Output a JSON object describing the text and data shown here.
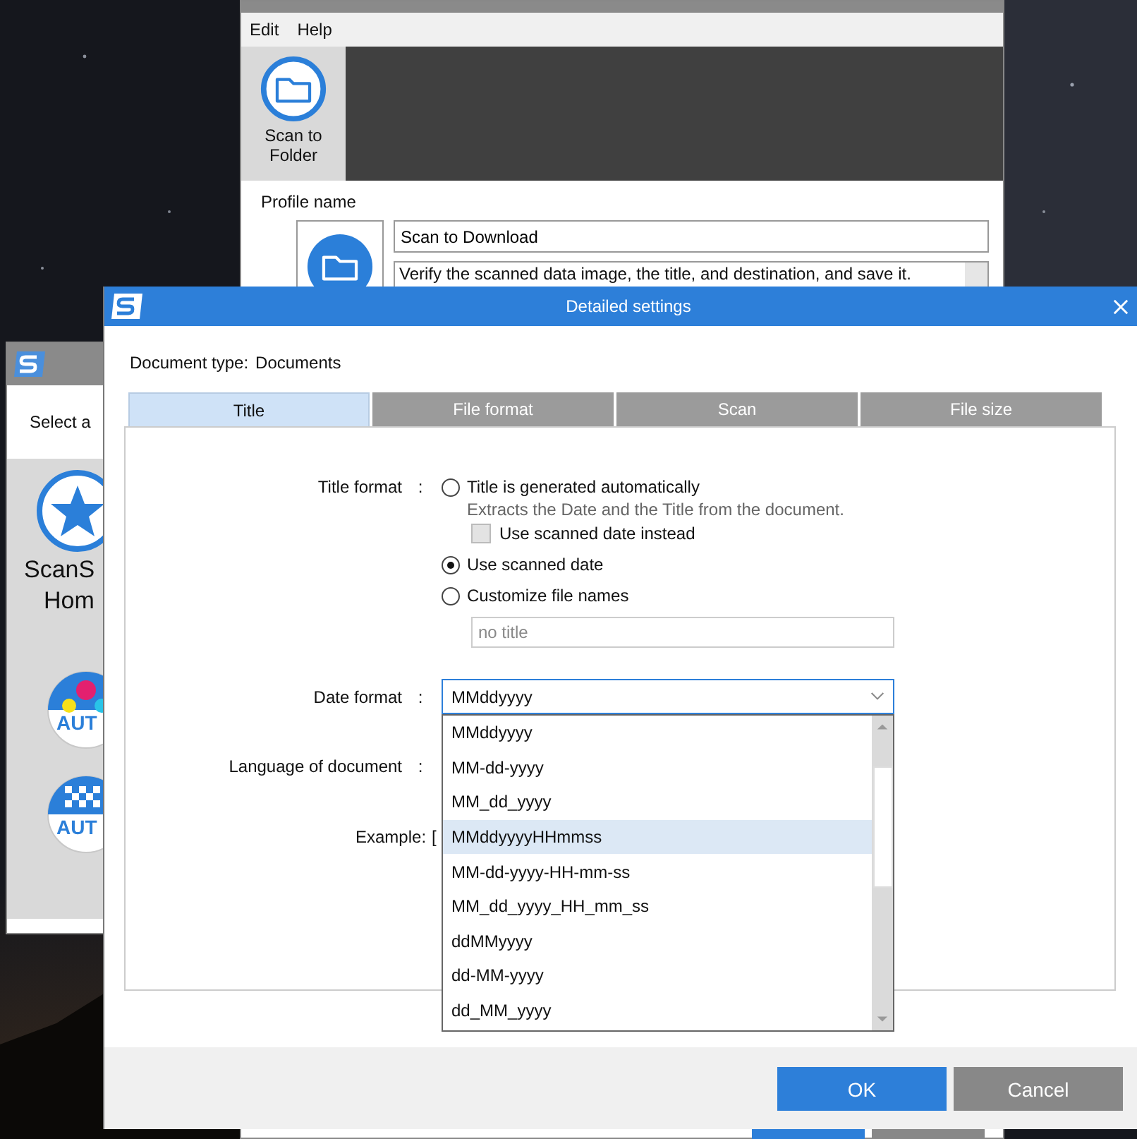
{
  "main_window": {
    "menu": [
      "Edit",
      "Help"
    ],
    "sidebar": [
      {
        "label": "Scan to Folder",
        "selected": true
      }
    ],
    "profile_name_label": "Profile name",
    "profile_name": "Scan to Download",
    "description": "Verify the scanned data image, the title, and destination, and save it."
  },
  "left_window": {
    "prompt": "Select a",
    "items": [
      {
        "kind": "star",
        "lines": [
          "ScanS",
          "Hom"
        ]
      },
      {
        "kind": "color_auto",
        "label": "AUT"
      },
      {
        "kind": "mono_auto",
        "label": "AUT"
      }
    ]
  },
  "dialog": {
    "title": "Detailed settings",
    "document_type_label": "Document type:",
    "document_type": "Documents",
    "tabs": [
      {
        "label": "Title",
        "selected": true
      },
      {
        "label": "File format",
        "selected": false
      },
      {
        "label": "Scan",
        "selected": false
      },
      {
        "label": "File size",
        "selected": false
      }
    ],
    "title_format": {
      "label": "Title format",
      "separator": ":",
      "options": [
        {
          "label": "Title is generated automatically",
          "selected": false,
          "note": "Extracts the Date and the Title from the document.",
          "checkbox": {
            "label": "Use scanned date instead",
            "checked": false,
            "disabled": true
          }
        },
        {
          "label": "Use scanned date",
          "selected": true
        },
        {
          "label": "Customize file names",
          "selected": false
        }
      ],
      "custom_name": {
        "placeholder": "no title"
      }
    },
    "date_format": {
      "label": "Date format",
      "separator": ":",
      "value": "MMddyyyy",
      "expanded": true,
      "options": [
        {
          "label": "MMddyyyy",
          "highlighted": false
        },
        {
          "label": "MM-dd-yyyy",
          "highlighted": false
        },
        {
          "label": "MM_dd_yyyy",
          "highlighted": false
        },
        {
          "label": "MMddyyyyHHmmss",
          "highlighted": true
        },
        {
          "label": "MM-dd-yyyy-HH-mm-ss",
          "highlighted": false
        },
        {
          "label": "MM_dd_yyyy_HH_mm_ss",
          "highlighted": false
        },
        {
          "label": "ddMMyyyy",
          "highlighted": false
        },
        {
          "label": "dd-MM-yyyy",
          "highlighted": false
        },
        {
          "label": "dd_MM_yyyy",
          "highlighted": false
        }
      ]
    },
    "language": {
      "label": "Language of document",
      "separator": ":"
    },
    "example": {
      "label": "Example:",
      "value": "["
    },
    "buttons": [
      {
        "label": "OK",
        "kind": "primary"
      },
      {
        "label": "Cancel",
        "kind": "secondary"
      }
    ]
  }
}
